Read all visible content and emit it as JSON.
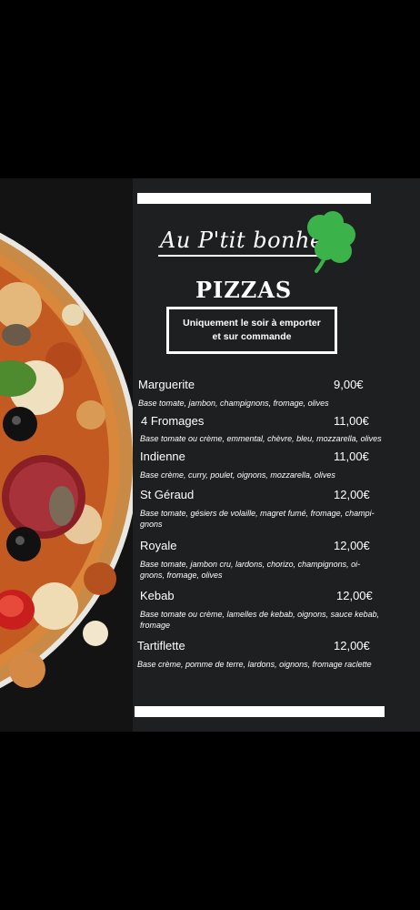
{
  "brand": {
    "name": "Au P'tit bonheur",
    "clover_color": "#3cb34a"
  },
  "section_title": "PIZZAS",
  "notice": "Uniquement le soir à emporter et sur commande",
  "items": [
    {
      "name": "Marguerite",
      "price": "9,00€",
      "desc": "Base tomate, jambon, champignons, fromage, olives"
    },
    {
      "name": "4 Fromages",
      "price": "11,00€",
      "desc": "Base tomate ou crème, emmental, chèvre, bleu, mozzarella, olives"
    },
    {
      "name": "Indienne",
      "price": "11,00€",
      "desc": "Base crème, curry, poulet, oignons, mozzarella, olives"
    },
    {
      "name": "St Géraud",
      "price": "12,00€",
      "desc": "Base tomate, gésiers de volaille, magret fumé, fromage, champi-gnons"
    },
    {
      "name": "Royale",
      "price": "12,00€",
      "desc": "Base tomate, jambon cru, lardons, chorizo, champignons, oi-gnons, fromage, olives"
    },
    {
      "name": "Kebab",
      "price": "12,00€",
      "desc": "Base tomate ou crème, lamelles de kebab, oignons, sauce kebab, fromage"
    },
    {
      "name": "Tartiflette",
      "price": "12,00€",
      "desc": "Base crème, pomme de terre, lardons, oignons, fromage raclette"
    }
  ]
}
